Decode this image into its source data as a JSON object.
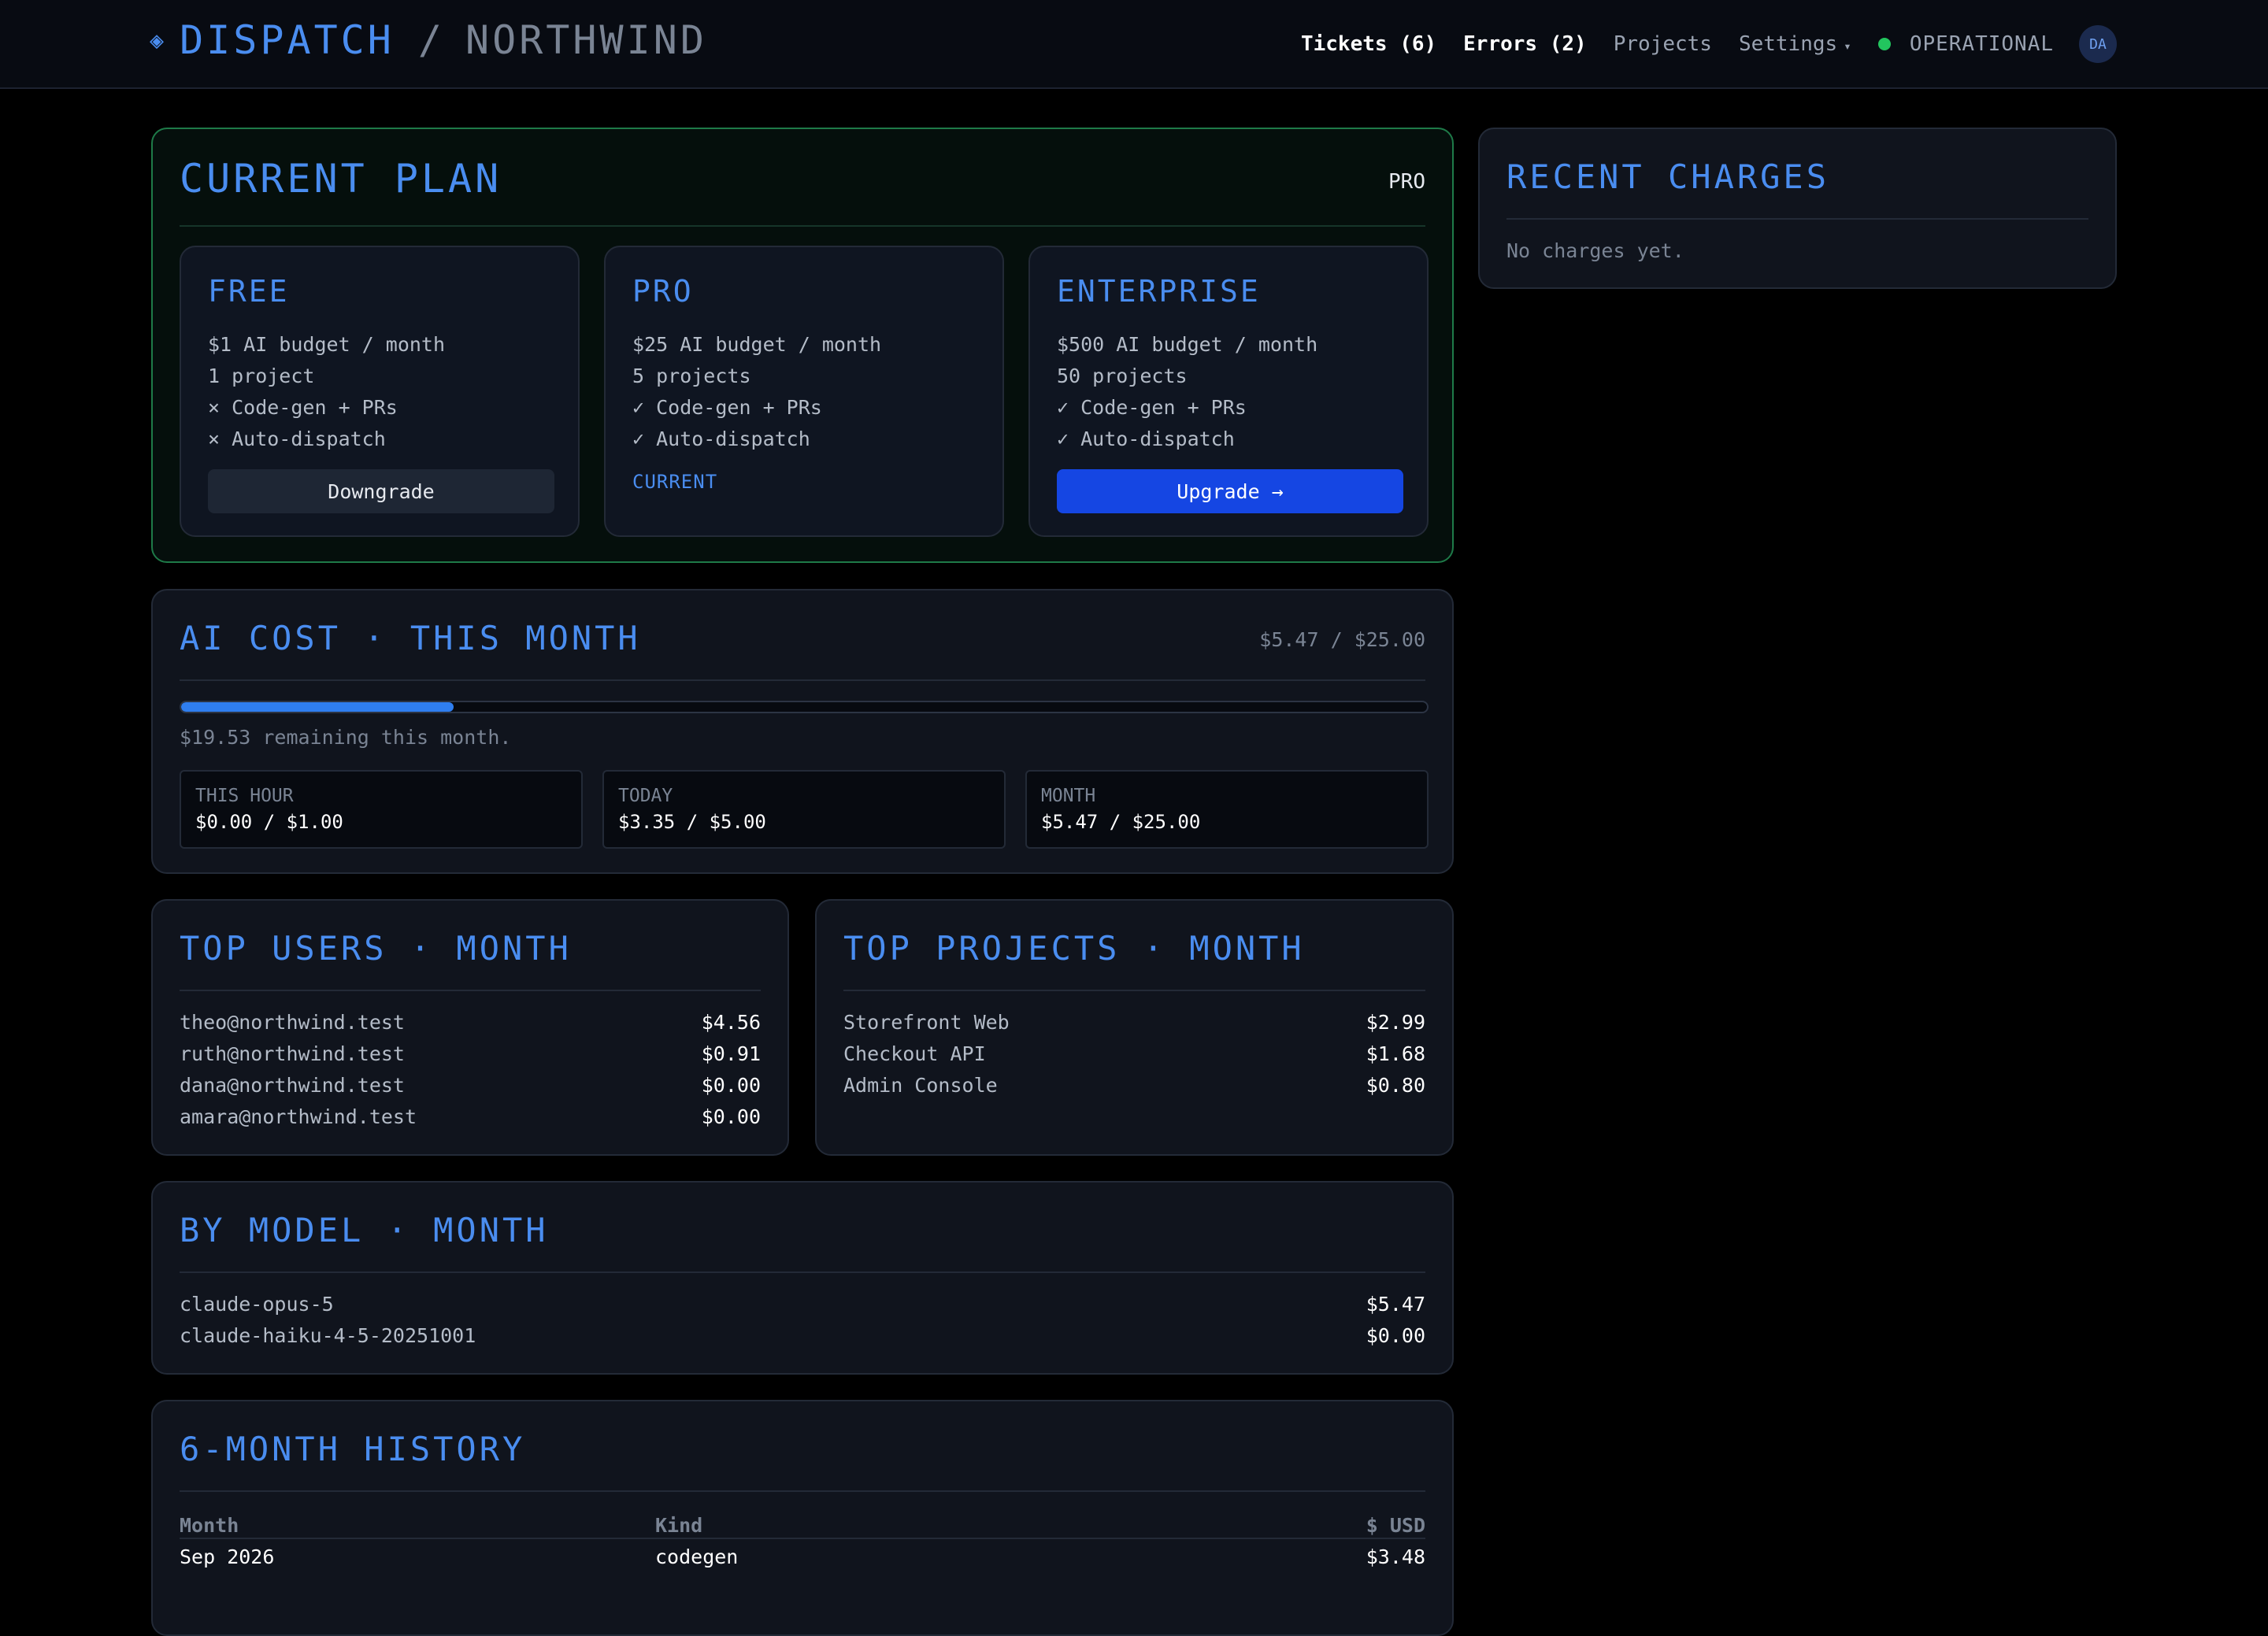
{
  "header": {
    "brand_icon": "◈",
    "brand": "DISPATCH",
    "separator": "/",
    "org": "NORTHWIND",
    "nav": {
      "tickets": "Tickets (6)",
      "errors": "Errors (2)",
      "projects": "Projects",
      "settings": "Settings",
      "settings_caret": "▾"
    },
    "status": "OPERATIONAL",
    "status_color": "#22c55e",
    "avatar": "DA"
  },
  "plan": {
    "title": "CURRENT PLAN",
    "badge": "PRO",
    "tiers": [
      {
        "name": "FREE",
        "lines": [
          "$1 AI budget / month",
          "1 project",
          "× Code-gen + PRs",
          "× Auto-dispatch"
        ],
        "action": "Downgrade"
      },
      {
        "name": "PRO",
        "lines": [
          "$25 AI budget / month",
          "5 projects",
          "✓ Code-gen + PRs",
          "✓ Auto-dispatch"
        ],
        "current": "CURRENT"
      },
      {
        "name": "ENTERPRISE",
        "lines": [
          "$500 AI budget / month",
          "50 projects",
          "✓ Code-gen + PRs",
          "✓ Auto-dispatch"
        ],
        "action": "Upgrade →"
      }
    ]
  },
  "ai_cost": {
    "title": "AI COST · THIS MONTH",
    "amount": "$5.47 / $25.00",
    "progress_fraction": 0.2188,
    "remaining": "$19.53 remaining this month.",
    "stats": [
      {
        "label": "THIS HOUR",
        "value": "$0.00 / $1.00"
      },
      {
        "label": "TODAY",
        "value": "$3.35 / $5.00"
      },
      {
        "label": "MONTH",
        "value": "$5.47 / $25.00"
      }
    ]
  },
  "top_users": {
    "title": "TOP USERS · MONTH",
    "rows": [
      {
        "name": "theo@northwind.test",
        "amount": "$4.56"
      },
      {
        "name": "ruth@northwind.test",
        "amount": "$0.91"
      },
      {
        "name": "dana@northwind.test",
        "amount": "$0.00"
      },
      {
        "name": "amara@northwind.test",
        "amount": "$0.00"
      }
    ]
  },
  "top_projects": {
    "title": "TOP PROJECTS · MONTH",
    "rows": [
      {
        "name": "Storefront Web",
        "amount": "$2.99"
      },
      {
        "name": "Checkout API",
        "amount": "$1.68"
      },
      {
        "name": "Admin Console",
        "amount": "$0.80"
      }
    ]
  },
  "by_model": {
    "title": "BY MODEL · MONTH",
    "rows": [
      {
        "name": "claude-opus-5",
        "amount": "$5.47"
      },
      {
        "name": "claude-haiku-4-5-20251001",
        "amount": "$0.00"
      }
    ]
  },
  "history": {
    "title": "6-MONTH HISTORY",
    "columns": [
      "Month",
      "Kind",
      "$ USD"
    ],
    "rows": [
      [
        "Sep 2026",
        "codegen",
        "$3.48"
      ]
    ]
  },
  "recent_charges": {
    "title": "RECENT CHARGES",
    "empty": "No charges yet."
  }
}
